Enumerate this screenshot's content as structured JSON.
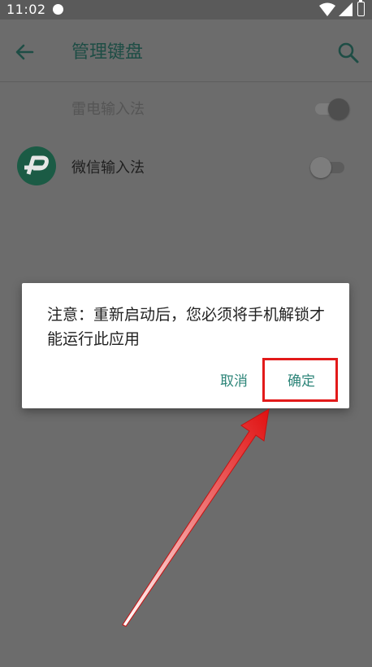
{
  "status_bar": {
    "time": "11:02"
  },
  "app_bar": {
    "title": "管理键盘"
  },
  "keyboards": [
    {
      "label": "雷电输入法",
      "enabled": true
    },
    {
      "label": "微信输入法",
      "enabled": false
    }
  ],
  "dialog": {
    "message": "注意：重新启动后，您必须将手机解锁才能运行此应用",
    "cancel_label": "取消",
    "confirm_label": "确定"
  },
  "colors": {
    "accent": "#2d8579",
    "title": "#1e4d45",
    "highlight": "#e21a1a"
  }
}
